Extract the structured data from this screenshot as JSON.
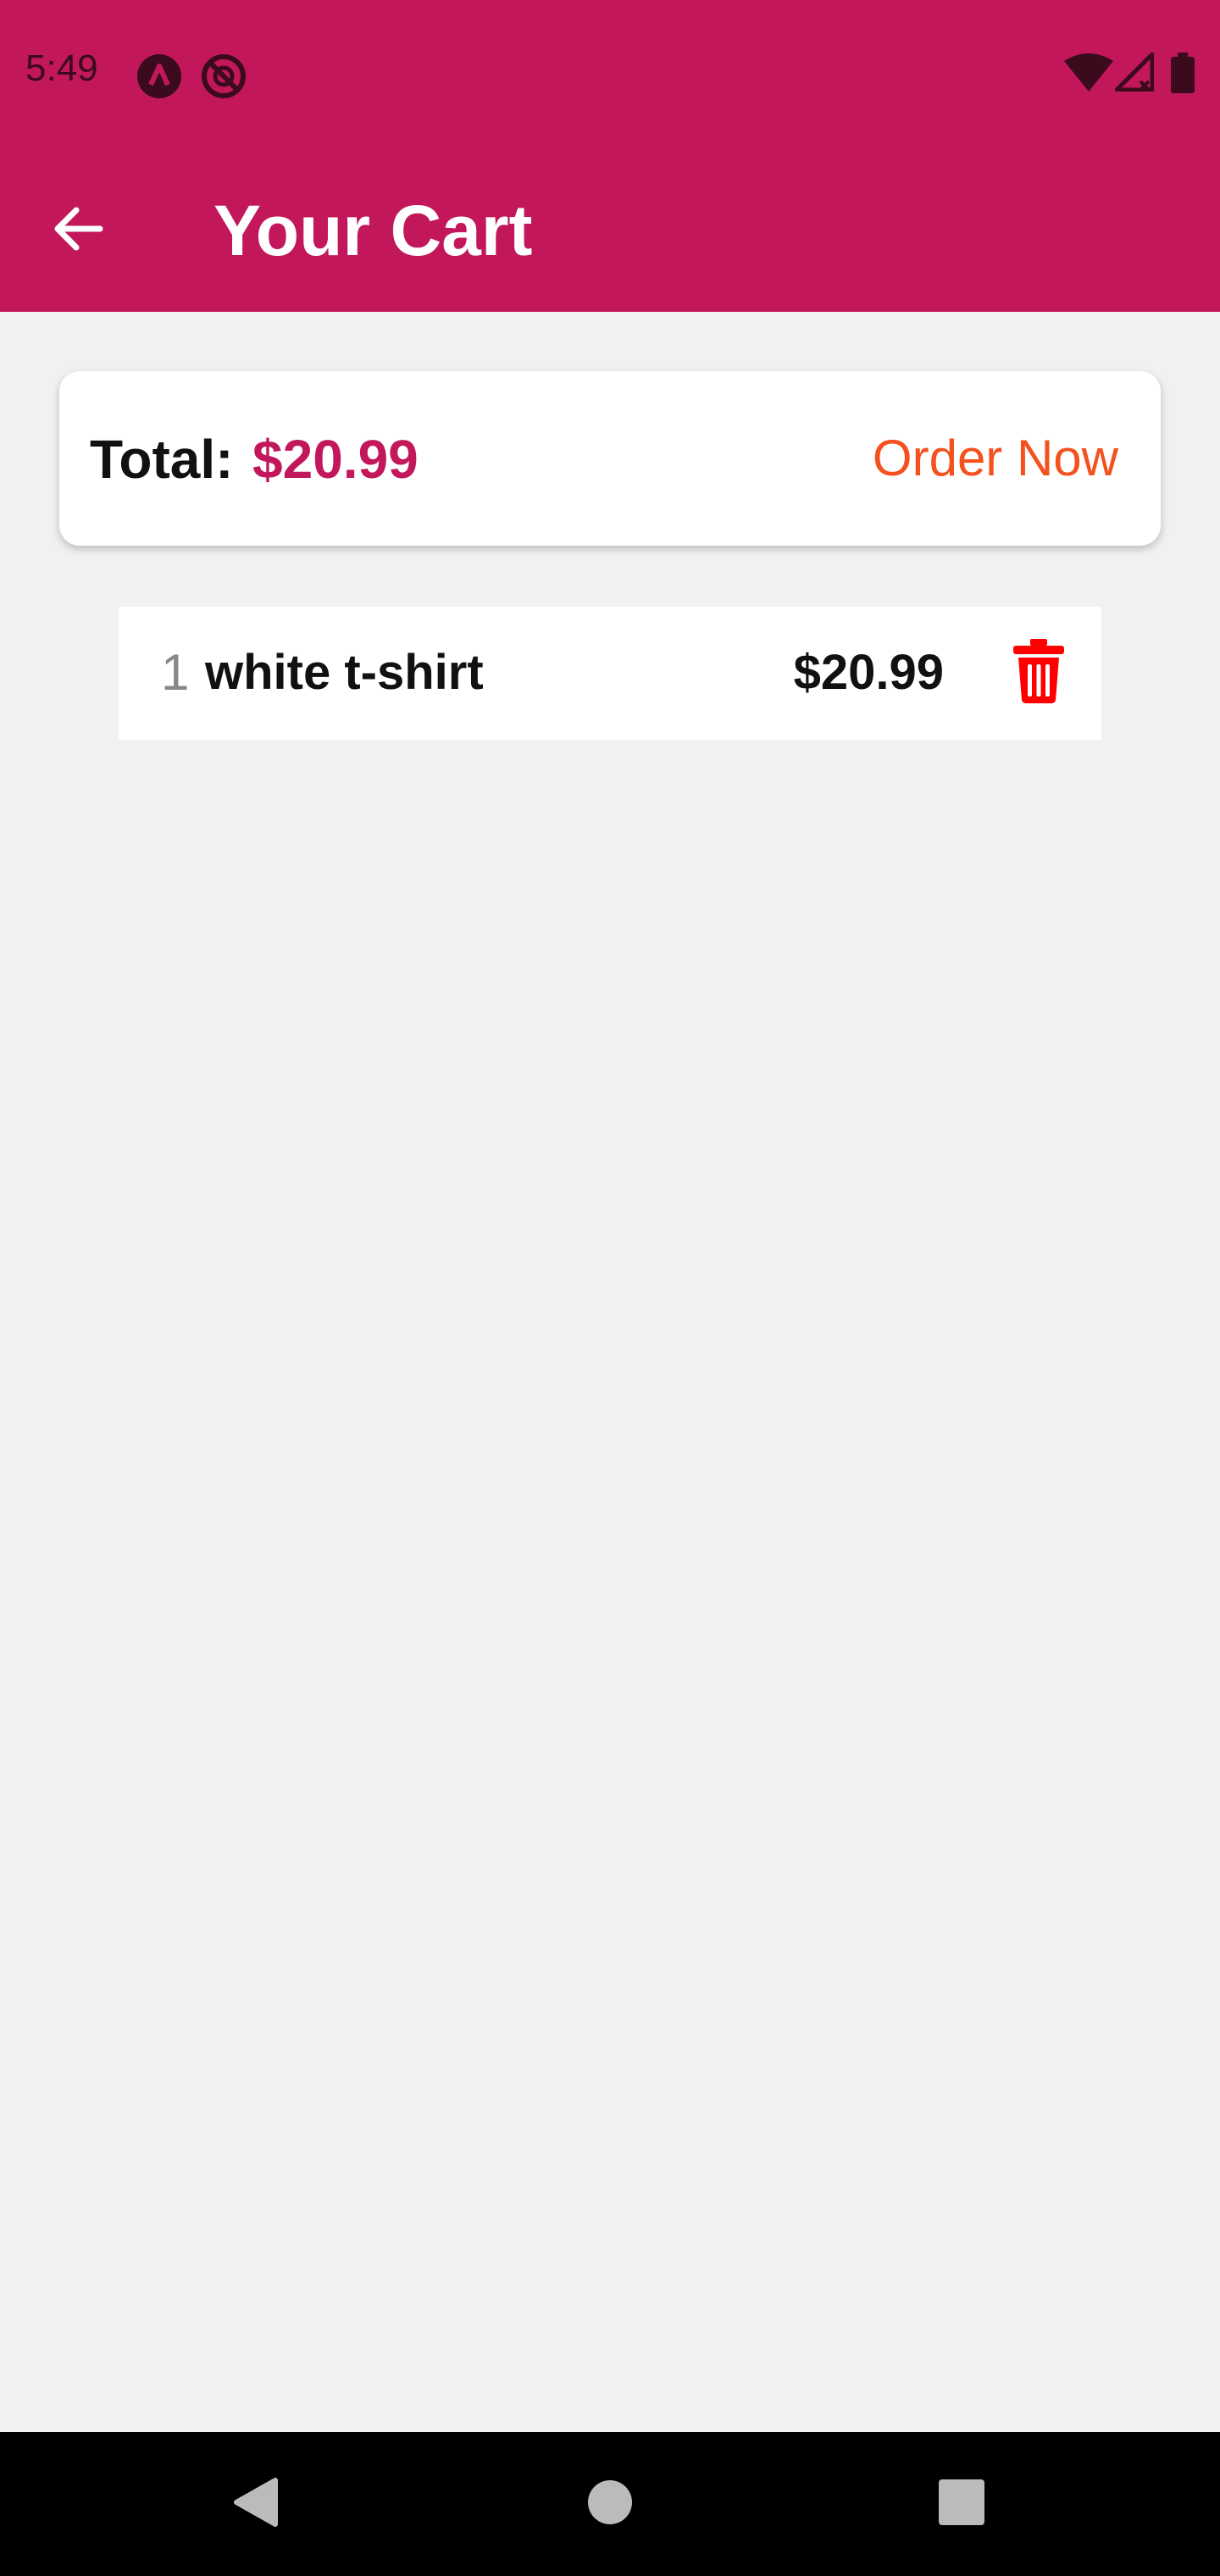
{
  "status_bar": {
    "time": "5:49",
    "background": "#c2185b",
    "icons": [
      "app-notification-icon",
      "blocked-notification-icon",
      "wifi-icon",
      "cell-signal-icon",
      "battery-icon"
    ]
  },
  "app_bar": {
    "title": "Your Cart",
    "back_icon": "arrow-left-icon",
    "background": "#c2185b"
  },
  "summary": {
    "total_label": "Total:",
    "total_amount": "$20.99",
    "order_button_label": "Order Now",
    "accent_color": "#c2185b",
    "order_color": "#f4511e"
  },
  "cart_items": [
    {
      "quantity": "1",
      "title": "white t-shirt",
      "price": "$20.99",
      "delete_icon": "trash-icon",
      "delete_color": "#ff0000"
    }
  ],
  "nav_bar": {
    "buttons": [
      "back-triangle-icon",
      "home-circle-icon",
      "recents-square-icon"
    ]
  }
}
